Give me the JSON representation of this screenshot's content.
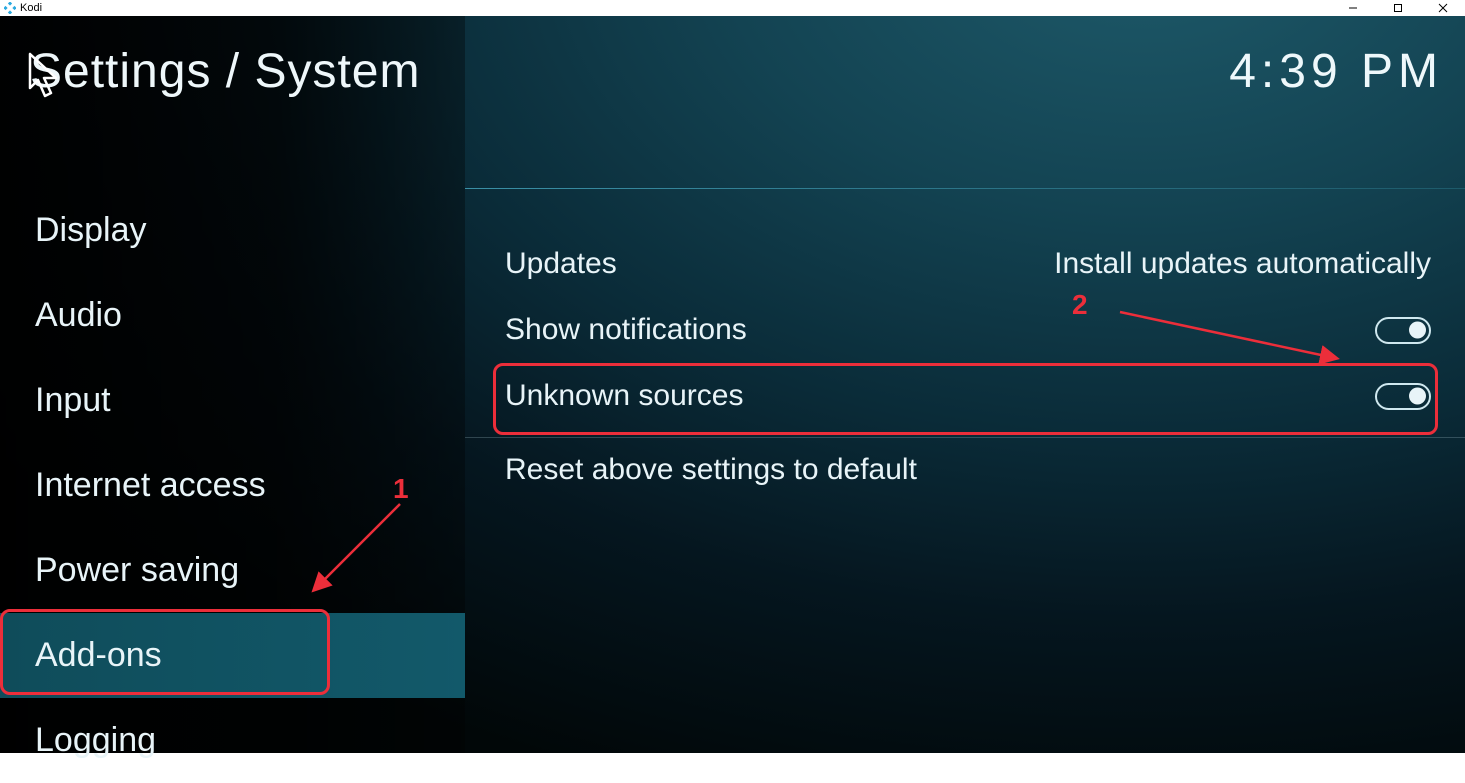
{
  "window": {
    "app_name": "Kodi"
  },
  "header": {
    "breadcrumb": "Settings / System",
    "clock": "4:39 PM"
  },
  "sidebar": {
    "items": [
      {
        "label": "Display"
      },
      {
        "label": "Audio"
      },
      {
        "label": "Input"
      },
      {
        "label": "Internet access"
      },
      {
        "label": "Power saving"
      },
      {
        "label": "Add-ons"
      },
      {
        "label": "Logging"
      }
    ],
    "active_index": 5
  },
  "settings": {
    "rows": [
      {
        "label": "Updates",
        "value": "Install updates automatically"
      },
      {
        "label": "Show notifications",
        "toggle": "on"
      },
      {
        "label": "Unknown sources",
        "toggle": "on"
      },
      {
        "label": "Reset above settings to default"
      }
    ]
  },
  "annotations": {
    "label1": "1",
    "label2": "2"
  }
}
